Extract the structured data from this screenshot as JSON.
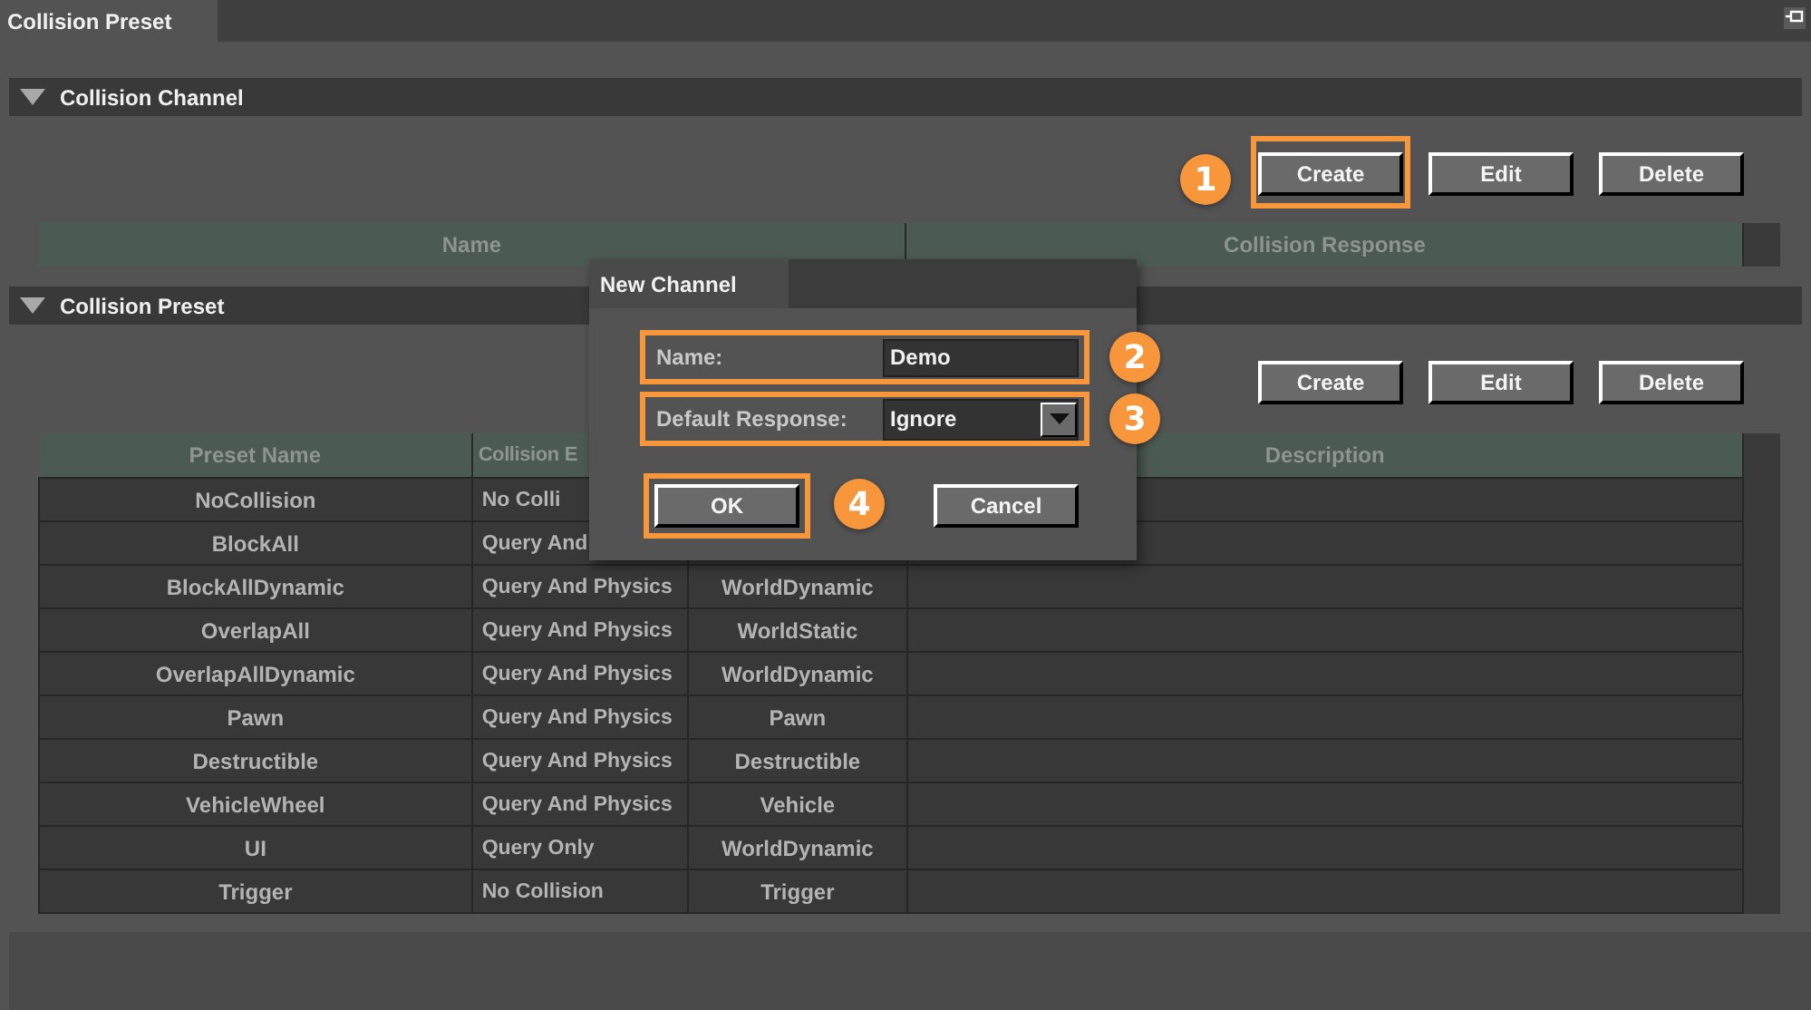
{
  "window": {
    "tab": "Collision Preset"
  },
  "channel_section": {
    "title": "Collision Channel",
    "expanded": true,
    "buttons": [
      {
        "label": "Create",
        "callout": "1"
      },
      {
        "label": "Edit"
      },
      {
        "label": "Delete"
      }
    ],
    "table": {
      "columns": [
        "Name",
        "Collision Response"
      ]
    }
  },
  "preset_section": {
    "title": "Collision Preset",
    "expanded": true,
    "buttons": [
      {
        "label": "Create"
      },
      {
        "label": "Edit"
      },
      {
        "label": "Delete"
      }
    ],
    "table": {
      "columns": [
        "Preset Name",
        "Collision E",
        null,
        "Description"
      ],
      "rows": [
        [
          "NoCollision",
          "No Colli",
          null,
          null
        ],
        [
          "BlockAll",
          "Query And",
          null,
          null
        ],
        [
          "BlockAllDynamic",
          "Query And Physics",
          "WorldDynamic",
          null
        ],
        [
          "OverlapAll",
          "Query And Physics",
          "WorldStatic",
          null
        ],
        [
          "OverlapAllDynamic",
          "Query And Physics",
          "WorldDynamic",
          null
        ],
        [
          "Pawn",
          "Query And Physics",
          "Pawn",
          null
        ],
        [
          "Destructible",
          "Query And Physics",
          "Destructible",
          null
        ],
        [
          "VehicleWheel",
          "Query And Physics",
          "Vehicle",
          null
        ],
        [
          "UI",
          "Query Only",
          "WorldDynamic",
          null
        ],
        [
          "Trigger",
          "No Collision",
          "Trigger",
          null
        ]
      ]
    }
  },
  "dialog": {
    "title": "New Channel",
    "name_field": {
      "label": "Name:",
      "value": "Demo",
      "callout": "2"
    },
    "response_field": {
      "label": "Default Response:",
      "value": "Ignore",
      "callout": "3"
    },
    "buttons": [
      {
        "label": "OK",
        "callout": "4"
      },
      {
        "label": "Cancel"
      }
    ]
  }
}
